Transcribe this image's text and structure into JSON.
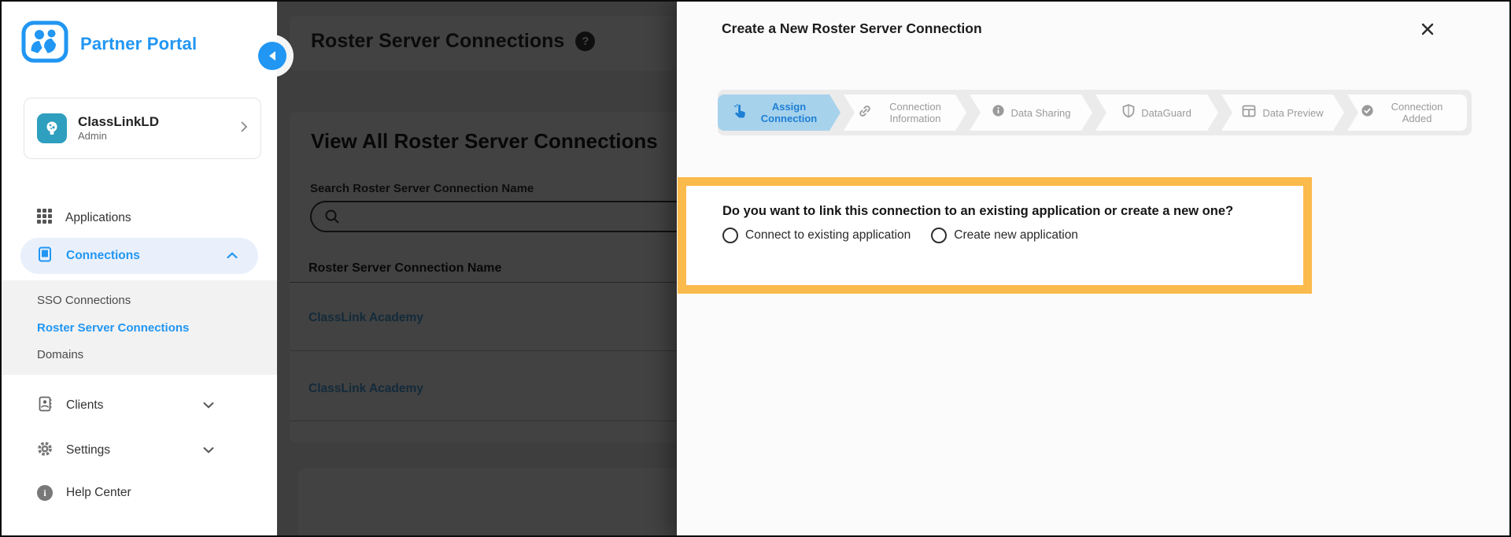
{
  "colors": {
    "accent_blue": "#2196F3",
    "sidebar_active_bg": "#E9F0FC",
    "active_step_bg": "#A7D2EC",
    "active_step_text": "#1E7FD4",
    "highlight_border": "#FBBA4C",
    "link_blue": "#4AA3E0",
    "avatar_teal": "#2E9FBE"
  },
  "sidebar": {
    "brand": "Partner Portal",
    "profile": {
      "name": "ClassLinkLD",
      "role": "Admin"
    },
    "nav": [
      {
        "label": "Applications"
      },
      {
        "label": "Connections",
        "expanded": true
      },
      {
        "label": "Clients"
      },
      {
        "label": "Settings"
      },
      {
        "label": "Help Center"
      }
    ],
    "subnav": [
      {
        "label": "SSO Connections",
        "active": false
      },
      {
        "label": "Roster Server Connections",
        "active": true
      },
      {
        "label": "Domains",
        "active": false
      }
    ]
  },
  "page": {
    "title": "Roster Server Connections",
    "help_badge": "?",
    "heading": "View All Roster Server Connections",
    "search_label": "Search Roster Server Connection Name",
    "table": {
      "header": "Roster Server Connection Name",
      "rows": [
        {
          "name": "ClassLink Academy"
        },
        {
          "name": "ClassLink Academy"
        }
      ]
    }
  },
  "modal": {
    "title": "Create a New Roster Server Connection",
    "close_label": "✕",
    "steps": [
      {
        "label": "Assign Connection",
        "icon": "pointer-hand-icon",
        "state": "active"
      },
      {
        "label": "Connection Information",
        "icon": "link-icon",
        "state": "upcoming"
      },
      {
        "label": "Data Sharing",
        "icon": "info-icon",
        "state": "upcoming"
      },
      {
        "label": "DataGuard",
        "icon": "shield-icon",
        "state": "upcoming"
      },
      {
        "label": "Data Preview",
        "icon": "table-icon",
        "state": "upcoming"
      },
      {
        "label": "Connection Added",
        "icon": "check-circle-icon",
        "state": "upcoming"
      }
    ],
    "question": "Do you want to link this connection to an existing application or create a new one?",
    "options": [
      {
        "label": "Connect to existing application",
        "selected": false
      },
      {
        "label": "Create new application",
        "selected": false
      }
    ]
  }
}
